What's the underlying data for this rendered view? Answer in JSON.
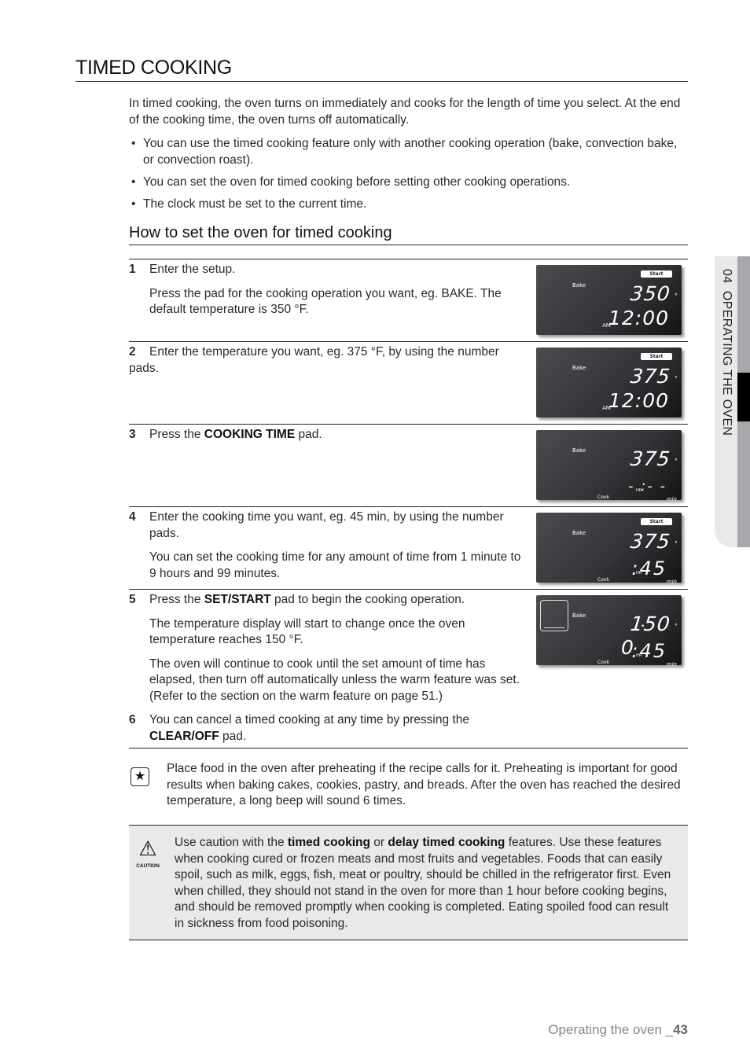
{
  "title": "TIMED COOKING",
  "intro": "In timed cooking, the oven turns on immediately and cooks for the length of time you select. At the end of the cooking time, the oven turns off automatically.",
  "bullets": [
    "You can use the timed cooking feature only with another cooking operation (bake, convection bake, or convection roast).",
    "You can set the oven for timed cooking before setting other cooking operations.",
    "The clock must be set to the current time."
  ],
  "subtitle": "How to set the oven for timed cooking",
  "steps": [
    {
      "num": "1",
      "text1": "Enter the setup.",
      "text2": "Press the pad for the cooking operation you want, eg. BAKE. The default temperature is 350 °F.",
      "display": {
        "mode": "Bake",
        "start": "Start",
        "temp": "350",
        "ampm": "AM",
        "clock": "12:00"
      }
    },
    {
      "num": "2",
      "text1": "Enter the temperature you want, eg. 375 °F, by using the number pads.",
      "display": {
        "mode": "Bake",
        "start": "Start",
        "temp": "375",
        "ampm": "AM",
        "clock": "12:00"
      }
    },
    {
      "num": "3",
      "text1_pre": "Press the ",
      "text1_bold": "COOKING TIME",
      "text1_post": " pad.",
      "display": {
        "mode": "Bake",
        "temp": "375",
        "cook": "Cook",
        "hr": "HR",
        "time": "- :- -",
        "min": "min"
      }
    },
    {
      "num": "4",
      "text1": "Enter the cooking time you want, eg. 45 min, by using the number pads.",
      "text2": "You can set the cooking time for any amount of time from 1 minute to 9 hours and 99 minutes.",
      "display": {
        "mode": "Bake",
        "start": "Start",
        "temp": "375",
        "cook": "Cook",
        "hr": "HR",
        "time": ":45",
        "min": "min"
      }
    },
    {
      "num": "5",
      "text1_pre": "Press the ",
      "text1_bold": "SET/START",
      "text1_post": " pad to begin the cooking operation.",
      "text2": "The temperature display will start to change once the oven temperature reaches 150 °F.",
      "text3": "The oven will continue to cook until the set amount of time has elapsed, then turn off automatically unless the warm feature was set. (Refer to the section on the warm feature on page 51.)",
      "display": {
        "mode": "Bake",
        "temp": "150",
        "cook": "Cook",
        "hr": "HR",
        "hrnum": "0",
        "time": ":45",
        "min": "min"
      }
    },
    {
      "num": "6",
      "text1_pre": "You can cancel a timed cooking at any time by pressing the ",
      "text1_bold": "CLEAR/OFF",
      "text1_post": " pad."
    }
  ],
  "note": {
    "icon": "star-note-icon",
    "text": "Place food in the oven after preheating if the recipe calls for it. Preheating is important for good results when baking cakes, cookies, pastry, and breads. After the oven has reached the desired temperature, a long beep will sound 6 times."
  },
  "caution": {
    "icon_label": "CAUTION",
    "pre": "Use caution with the ",
    "b1": "timed cooking",
    "mid": " or ",
    "b2": "delay timed cooking",
    "post": " features. Use these features when cooking cured or frozen meats and most fruits and vegetables. Foods that can easily spoil, such as milk, eggs, fish, meat or poultry, should be chilled in the refrigerator first. Even when chilled, they should not stand in the oven for more than 1 hour before cooking begins, and should be removed promptly when cooking is completed. Eating spoiled food can result in sickness from food poisoning."
  },
  "side_tab": "04  OPERATING THE OVEN",
  "footer": {
    "label": "Operating the oven _",
    "page": "43"
  }
}
